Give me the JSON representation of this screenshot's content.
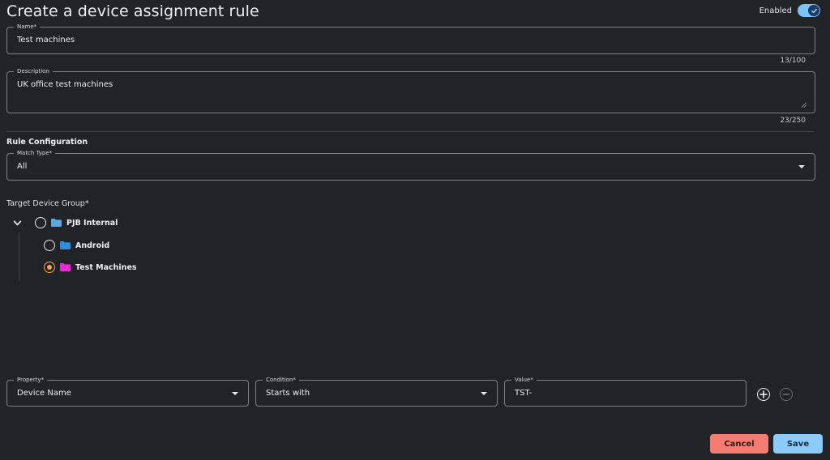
{
  "header": {
    "title": "Create a device assignment rule",
    "enabled_label": "Enabled",
    "enabled": true
  },
  "name_field": {
    "label": "Name*",
    "value": "Test machines",
    "counter": "13/100"
  },
  "description_field": {
    "label": "Description",
    "value": "UK office test machines",
    "counter": "23/250"
  },
  "rule_config": {
    "title": "Rule Configuration",
    "match_type": {
      "label": "Match Type*",
      "value": "All"
    }
  },
  "target_group": {
    "label": "Target Device Group*",
    "tree": [
      {
        "label": "PJB Internal",
        "folder_color": "#5aa9e6",
        "selected": false,
        "expanded": true
      },
      {
        "label": "Android",
        "folder_color": "#2f8fd8",
        "selected": false
      },
      {
        "label": "Test Machines",
        "folder_color": "#e02fd0",
        "selected": true
      }
    ]
  },
  "condition_row": {
    "property": {
      "label": "Property*",
      "value": "Device Name"
    },
    "condition": {
      "label": "Condition*",
      "value": "Starts with"
    },
    "value": {
      "label": "Value*",
      "value": "TST-"
    },
    "add_icon": "plus-circle-icon",
    "remove_icon": "minus-circle-icon"
  },
  "actions": {
    "cancel_label": "Cancel",
    "save_label": "Save"
  },
  "colors": {
    "background": "#212327",
    "accent": "#8ccbf7",
    "danger": "#f47c73",
    "radio_selected": "#f5a742"
  }
}
